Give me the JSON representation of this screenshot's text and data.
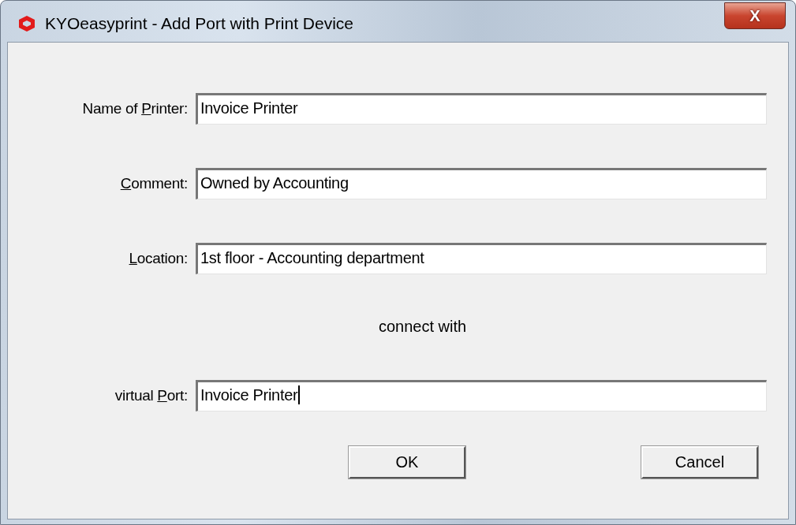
{
  "window": {
    "title": "KYOeasyprint - Add Port with Print Device",
    "close_label": "X"
  },
  "fields": [
    {
      "label": {
        "before": "Name of ",
        "key": "P",
        "after": "rinter:"
      },
      "value": "Invoice Printer",
      "focused": false
    },
    {
      "label": {
        "key": "C",
        "after": "omment:"
      },
      "value": "Owned by Accounting",
      "focused": false
    },
    {
      "label": {
        "key": "L",
        "after": "ocation:"
      },
      "value": "1st floor - Accounting department",
      "focused": false
    }
  ],
  "connect_text": "connect with",
  "port_field": {
    "label": {
      "before": "virtual ",
      "key": "P",
      "after": "ort:"
    },
    "value": "Invoice Printer",
    "focused": true
  },
  "buttons": [
    "OK",
    "Cancel"
  ]
}
